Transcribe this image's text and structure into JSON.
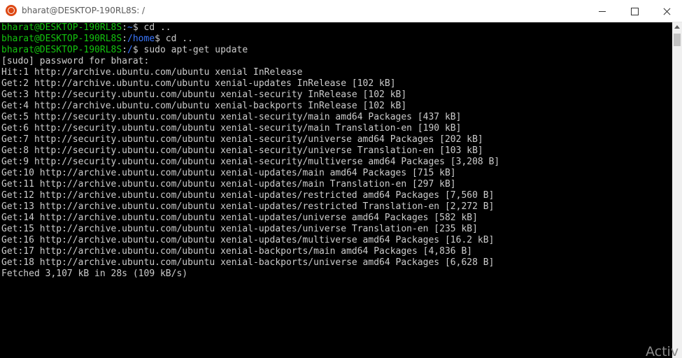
{
  "window": {
    "title": "bharat@DESKTOP-190RL8S: /"
  },
  "terminal": {
    "prompts": [
      {
        "user": "bharat@DESKTOP-190RL8S",
        "sep": ":",
        "path": "~",
        "cmd": "$ cd .."
      },
      {
        "user": "bharat@DESKTOP-190RL8S",
        "sep": ":",
        "path": "/home",
        "cmd": "$ cd .."
      },
      {
        "user": "bharat@DESKTOP-190RL8S",
        "sep": ":",
        "path": "/",
        "cmd": "$ sudo apt-get update"
      }
    ],
    "output": [
      "[sudo] password for bharat:",
      "Hit:1 http://archive.ubuntu.com/ubuntu xenial InRelease",
      "Get:2 http://archive.ubuntu.com/ubuntu xenial-updates InRelease [102 kB]",
      "Get:3 http://security.ubuntu.com/ubuntu xenial-security InRelease [102 kB]",
      "Get:4 http://archive.ubuntu.com/ubuntu xenial-backports InRelease [102 kB]",
      "Get:5 http://security.ubuntu.com/ubuntu xenial-security/main amd64 Packages [437 kB]",
      "Get:6 http://security.ubuntu.com/ubuntu xenial-security/main Translation-en [190 kB]",
      "Get:7 http://security.ubuntu.com/ubuntu xenial-security/universe amd64 Packages [202 kB]",
      "Get:8 http://security.ubuntu.com/ubuntu xenial-security/universe Translation-en [103 kB]",
      "Get:9 http://security.ubuntu.com/ubuntu xenial-security/multiverse amd64 Packages [3,208 B]",
      "Get:10 http://archive.ubuntu.com/ubuntu xenial-updates/main amd64 Packages [715 kB]",
      "Get:11 http://archive.ubuntu.com/ubuntu xenial-updates/main Translation-en [297 kB]",
      "Get:12 http://archive.ubuntu.com/ubuntu xenial-updates/restricted amd64 Packages [7,560 B]",
      "Get:13 http://archive.ubuntu.com/ubuntu xenial-updates/restricted Translation-en [2,272 B]",
      "Get:14 http://archive.ubuntu.com/ubuntu xenial-updates/universe amd64 Packages [582 kB]",
      "Get:15 http://archive.ubuntu.com/ubuntu xenial-updates/universe Translation-en [235 kB]",
      "Get:16 http://archive.ubuntu.com/ubuntu xenial-updates/multiverse amd64 Packages [16.2 kB]",
      "Get:17 http://archive.ubuntu.com/ubuntu xenial-backports/main amd64 Packages [4,836 B]",
      "Get:18 http://archive.ubuntu.com/ubuntu xenial-backports/universe amd64 Packages [6,628 B]",
      "Fetched 3,107 kB in 28s (109 kB/s)"
    ]
  },
  "watermark": "Activ",
  "icons": {
    "app": "ubuntu-icon",
    "minimize": "minimize-icon",
    "maximize": "maximize-icon",
    "close": "close-icon",
    "scroll_up": "scroll-up-arrow-icon"
  },
  "colors": {
    "background": "#000000",
    "text": "#cccccc",
    "prompt_user": "#13c40e",
    "prompt_path": "#3b78ff",
    "ubuntu_orange": "#dd4814"
  }
}
